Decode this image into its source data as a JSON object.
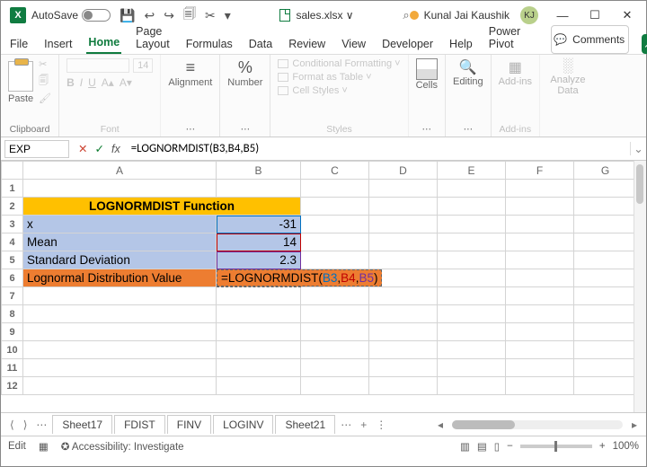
{
  "titlebar": {
    "autosave_label": "AutoSave",
    "autosave_state": "Off",
    "filename": "sales.xlsx ∨",
    "search_icon": "⌕",
    "user_name": "Kunal Jai Kaushik",
    "user_initials": "KJ"
  },
  "qat": {
    "save": "💾",
    "undo": "↩",
    "redo": "↪",
    "ext1": "🗐",
    "ext2": "✂",
    "dd": "▾"
  },
  "ribbon_tabs": {
    "file": "File",
    "insert": "Insert",
    "home": "Home",
    "page_layout": "Page Layout",
    "formulas": "Formulas",
    "data": "Data",
    "review": "Review",
    "view": "View",
    "developer": "Developer",
    "help": "Help",
    "power_pivot": "Power Pivot",
    "comments": "Comments",
    "share_glyph": "↗"
  },
  "ribbon": {
    "clipboard": {
      "paste": "Paste",
      "group": "Clipboard"
    },
    "font": {
      "group": "Font",
      "size": "14"
    },
    "alignment": {
      "label": "Alignment",
      "group": "⋯"
    },
    "number": {
      "label": "Number",
      "pct": "%",
      "group": "⋯"
    },
    "styles": {
      "cond_fmt": "Conditional Formatting ˅",
      "as_table": "Format as Table ˅",
      "cell_styles": "Cell Styles ˅",
      "group": "Styles"
    },
    "cells": {
      "label": "Cells",
      "group": "⋯"
    },
    "editing": {
      "label": "Editing",
      "group": "⋯"
    },
    "addins": {
      "label": "Add-ins",
      "group": "Add-ins"
    },
    "analyze": {
      "label": "Analyze Data",
      "group": ""
    }
  },
  "formula_bar": {
    "name_box": "EXP",
    "cancel": "✕",
    "enter": "✓",
    "fx": "fx",
    "formula": "=LOGNORMDIST(B3,B4,B5)"
  },
  "columns": {
    "A": "A",
    "B": "B",
    "C": "C",
    "D": "D",
    "E": "E",
    "F": "F",
    "G": "G"
  },
  "rows": {
    "r1": "1",
    "r2": "2",
    "r3": "3",
    "r4": "4",
    "r5": "5",
    "r6": "6",
    "r7": "7",
    "r8": "8",
    "r9": "9",
    "r10": "10",
    "r11": "11",
    "r12": "12"
  },
  "sheet": {
    "header_title": "LOGNORMDIST Function",
    "r3": {
      "label": "x",
      "val": "-31"
    },
    "r4": {
      "label": "Mean",
      "val": "14"
    },
    "r5": {
      "label": "Standard Deviation",
      "val": "2.3"
    },
    "r6": {
      "label": "Lognormal Distribution Value",
      "prefix": "=LOGNORMDIST(",
      "a1": "B3",
      "c1": ",",
      "a2": "B4",
      "c2": ",",
      "a3": "B5",
      "suffix": ")"
    }
  },
  "sheet_tabs": {
    "prev": "⟨",
    "next": "⟩",
    "more": "⋯",
    "t1": "Sheet17",
    "t2": "FDIST",
    "t3": "FINV",
    "t4": "LOGINV",
    "t5": "Sheet21",
    "more2": "⋯",
    "add": "+",
    "menu": "⋮"
  },
  "status": {
    "mode": "Edit",
    "acc": "Accessibility: Investigate",
    "zoom_out": "−",
    "zoom_in": "+",
    "zoom": "100%"
  }
}
